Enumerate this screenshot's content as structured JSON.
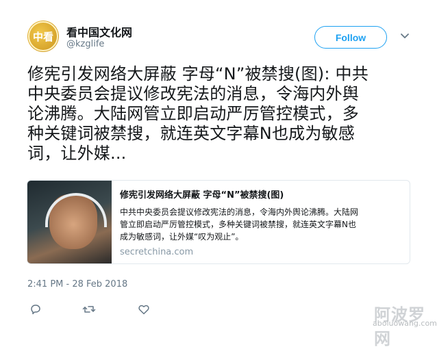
{
  "account": {
    "display_name": "看中国文化网",
    "handle": "@kzglife",
    "avatar_text": "中看"
  },
  "follow_label": "Follow",
  "tweet": {
    "lines": [
      "修宪引发网络大屏蔽 字母“N”被禁搜(图): 中共",
      "中央委员会提议修改宪法的消息，令海内外舆",
      "论沸腾。大陆网管立即启动严厉管控模式，多",
      "种关键词被禁搜，就连英文字幕N也成为敏感",
      "词，让外媒..."
    ]
  },
  "card": {
    "title": "修宪引发网络大屏蔽 字母“N”被禁搜(图)",
    "desc_lines": [
      "中共中央委员会提议修改宪法的消息，令海内外舆论沸腾。大陆网",
      "管立即启动严厉管控模式，多种关键词被禁搜，就连英文字幕N也",
      "成为敏感词，让外媒“叹为观止”。"
    ],
    "domain": "secretchina.com"
  },
  "timestamp": "2:41 PM - 28 Feb 2018",
  "watermark": {
    "cn": "阿波罗网",
    "en": "aboluowang.com"
  },
  "icons": [
    "reply-icon",
    "retweet-icon",
    "like-icon",
    "chevron-down-icon"
  ],
  "colors": {
    "accent": "#1da1f2",
    "muted": "#657786",
    "border": "#e1e8ed"
  }
}
